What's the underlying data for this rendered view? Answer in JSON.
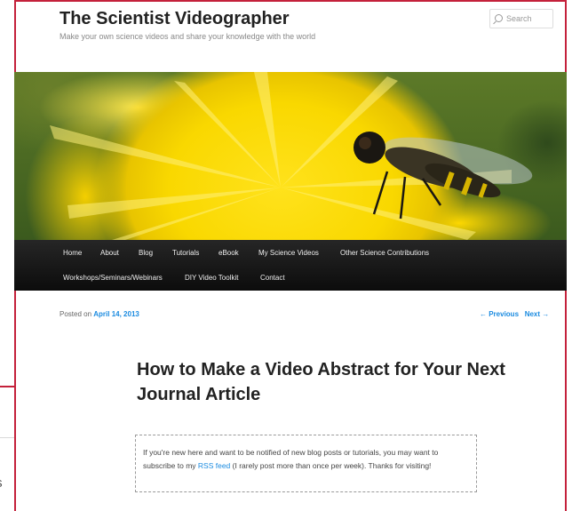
{
  "site": {
    "title": "The Scientist Videographer",
    "tagline": "Make your own science videos and share your knowledge with the world"
  },
  "search": {
    "placeholder": "Search"
  },
  "nav": {
    "row1": [
      "Home",
      "About",
      "Blog",
      "Tutorials",
      "eBook",
      "My Science Videos",
      "Other Science Contributions"
    ],
    "row2": [
      "Workshops/Seminars/Webinars",
      "DIY Video Toolkit",
      "Contact"
    ]
  },
  "post": {
    "posted_prefix": "Posted on",
    "date": "April 14, 2013",
    "previous": "← Previous",
    "next": "Next →",
    "title": "How to Make a Video Abstract for Your Next Journal Article",
    "notice_before": "If you're new here and want to be notified of new blog posts or tutorials, you may want to subscribe to my ",
    "notice_link": "RSS feed",
    "notice_after": " (I rarely post more than once per week). Thanks for visiting!"
  },
  "background_window": {
    "fragment_text": "ts"
  },
  "colors": {
    "frame": "#c4213b",
    "link": "#1b8be0",
    "nav_bg": "#1a1a1a"
  }
}
